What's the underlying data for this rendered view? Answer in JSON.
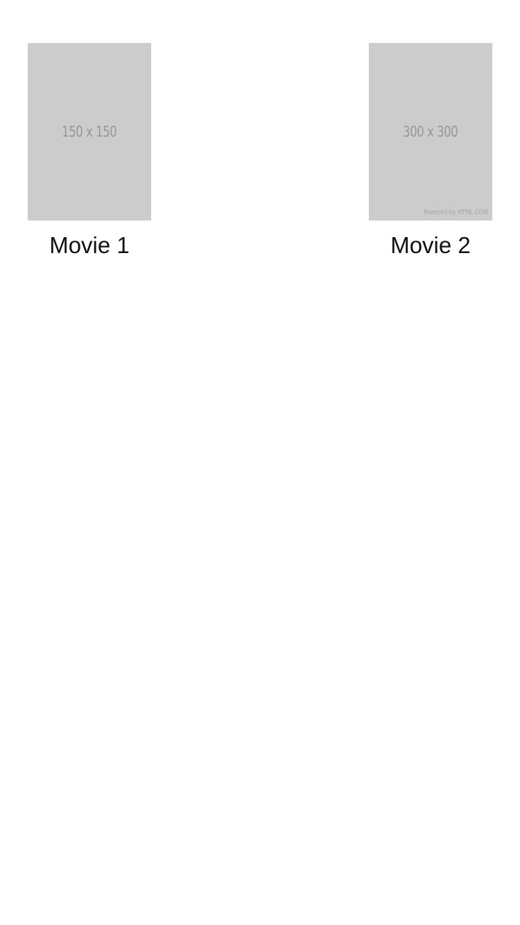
{
  "movies": [
    {
      "title": "Movie 1",
      "poster_placeholder": "150 x 150",
      "poster_credit": ""
    },
    {
      "title": "Movie 2",
      "poster_placeholder": "300 x 300",
      "poster_credit": "Powered by HTML.COM"
    }
  ],
  "colors": {
    "background": "#ffffff",
    "poster_fill": "#cccccc",
    "poster_text": "#969696",
    "title_text": "#111111"
  }
}
